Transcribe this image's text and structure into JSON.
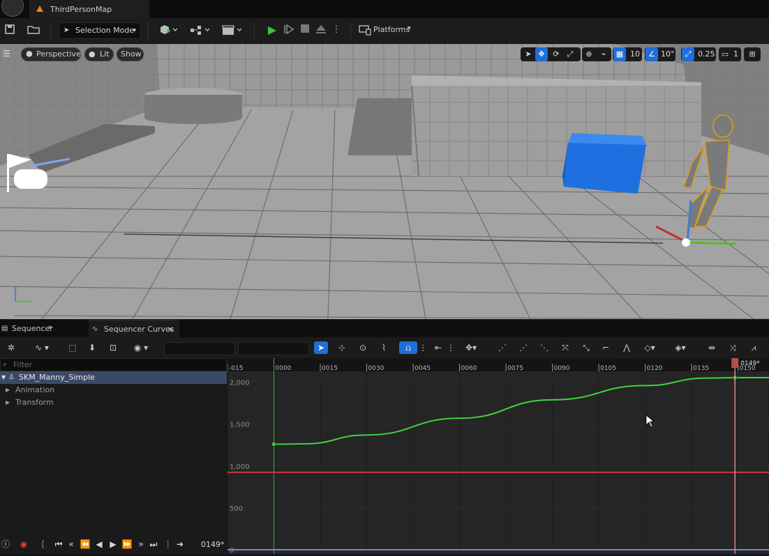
{
  "title_bar": {
    "tab_title": "ThirdPersonMap"
  },
  "toolbar": {
    "mode_label": "Selection Mode",
    "platforms_label": "Platforms"
  },
  "viewport_bar": {
    "perspective_label": "Perspective",
    "lit_label": "Lit",
    "show_label": "Show",
    "grid_snap_value": "10",
    "rotation_snap_value": "10°",
    "scale_snap_value": "0.25",
    "camera_speed_value": "1"
  },
  "sequencer": {
    "tab_sequencer": "Sequencer",
    "tab_curves": "Sequencer Curves",
    "filter_placeholder": "Filter",
    "tree": [
      {
        "label": "SKM_Manny_Simple"
      },
      {
        "label": "Animation"
      },
      {
        "label": "Transform"
      }
    ],
    "current_frame": "0149*",
    "playhead_label": "0149*",
    "ruler_ticks": [
      "-015",
      "0000",
      "0015",
      "0030",
      "0045",
      "0060",
      "0075",
      "0090",
      "0105",
      "0120",
      "0135",
      "0150"
    ],
    "y_labels": [
      "2,000",
      "1,500",
      "1,000",
      "500",
      "0"
    ]
  },
  "chart_data": {
    "type": "line",
    "xlim": [
      -15,
      160
    ],
    "ylim": [
      -50,
      2130
    ],
    "grid": true,
    "series": [
      {
        "color": "#3fd43f",
        "x": [
          0,
          10,
          30,
          60,
          90,
          120,
          140,
          149,
          160
        ],
        "y": [
          1260,
          1265,
          1370,
          1570,
          1790,
          1960,
          2050,
          2055,
          2055
        ]
      },
      {
        "color": "#c83b3b",
        "x": [
          -15,
          160
        ],
        "y": [
          925,
          925
        ]
      },
      {
        "color": "#6b8ccf",
        "x": [
          -15,
          160
        ],
        "y": [
          0,
          0
        ]
      }
    ],
    "keyframes": [
      {
        "x": 0,
        "y": 1260
      },
      {
        "x": 149,
        "y": 2055
      }
    ]
  }
}
